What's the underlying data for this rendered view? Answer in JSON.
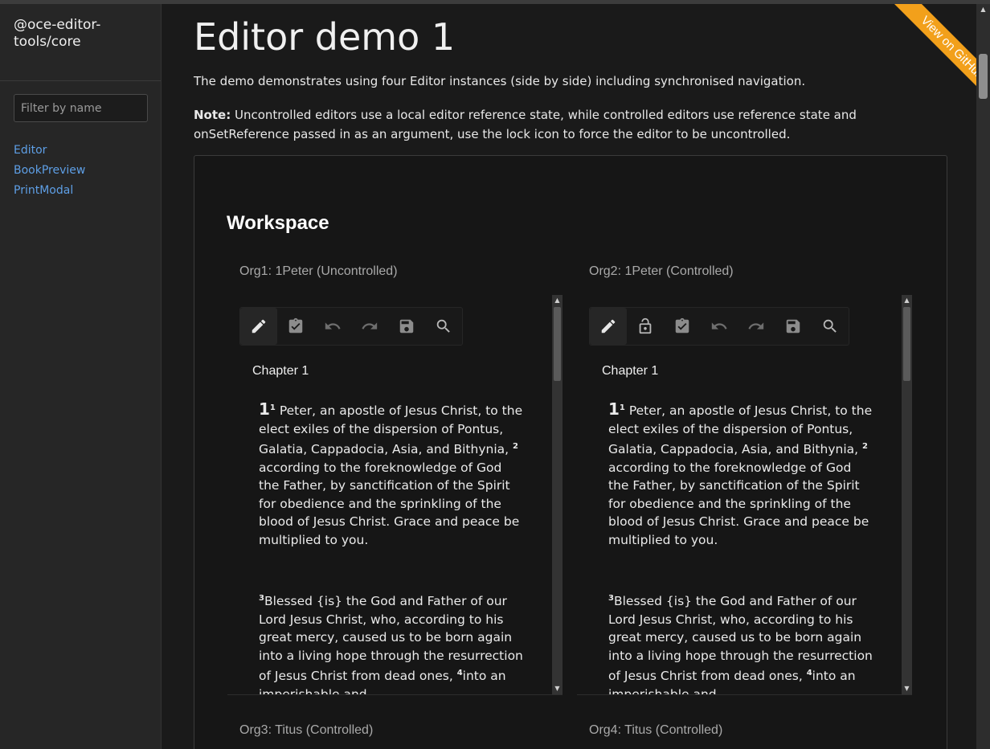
{
  "brand": {
    "title": "@oce-editor-tools/core"
  },
  "sidebar": {
    "filter": {
      "placeholder": "Filter by name",
      "value": ""
    },
    "items": [
      {
        "label": "Editor"
      },
      {
        "label": "BookPreview"
      },
      {
        "label": "PrintModal"
      }
    ]
  },
  "page": {
    "title": "Editor demo 1",
    "intro": "The demo demonstrates using four Editor instances (side by side) including synchronised navigation.",
    "note_label": "Note:",
    "note_text": " Uncontrolled editors use a local editor reference state, while controlled editors use reference state and onSetReference passed in as an argument, use the lock icon to force the editor to be uncontrolled."
  },
  "ribbon": {
    "label": "View on GitHub",
    "color": "#f2a01b"
  },
  "workspace": {
    "title": "Workspace",
    "panes": [
      {
        "label": "Org1: 1Peter (Uncontrolled)",
        "tools": [
          "pencil-icon",
          "clipboard-check-icon",
          "undo-icon",
          "redo-icon",
          "save-icon",
          "search-icon"
        ],
        "chapter": "Chapter 1",
        "chapter_number": "1",
        "v1": "1",
        "v1_text": "Peter, an apostle of Jesus Christ, to the elect exiles of the dispersion of Pontus, Galatia, Cappadocia, Asia, and Bithynia, ",
        "v2": "2",
        "v2_text": "according to the foreknowledge of God the Father, by sanctification of the Spirit for obedience and the sprinkling of the blood of Jesus Christ. Grace and peace be multiplied to you.",
        "v3": "3",
        "v3_text": "Blessed {is} the God and Father of our Lord Jesus Christ, who, according to his great mercy, caused us to be born again into a living hope through the resurrection of Jesus Christ from dead ones, ",
        "v4": "4",
        "v4_text": "into an imperishable and"
      },
      {
        "label": "Org2: 1Peter (Controlled)",
        "tools": [
          "pencil-icon",
          "lock-icon",
          "clipboard-check-icon",
          "undo-icon",
          "redo-icon",
          "save-icon",
          "search-icon"
        ],
        "chapter": "Chapter 1",
        "chapter_number": "1",
        "v1": "1",
        "v1_text": "Peter, an apostle of Jesus Christ, to the elect exiles of the dispersion of Pontus, Galatia, Cappadocia, Asia, and Bithynia, ",
        "v2": "2",
        "v2_text": "according to the foreknowledge of God the Father, by sanctification of the Spirit for obedience and the sprinkling of the blood of Jesus Christ. Grace and peace be multiplied to you.",
        "v3": "3",
        "v3_text": "Blessed {is} the God and Father of our Lord Jesus Christ, who, according to his great mercy, caused us to be born again into a living hope through the resurrection of Jesus Christ from dead ones, ",
        "v4": "4",
        "v4_text": "into an imperishable and"
      },
      {
        "label": "Org3: Titus (Controlled)"
      },
      {
        "label": "Org4: Titus (Controlled)"
      }
    ]
  }
}
